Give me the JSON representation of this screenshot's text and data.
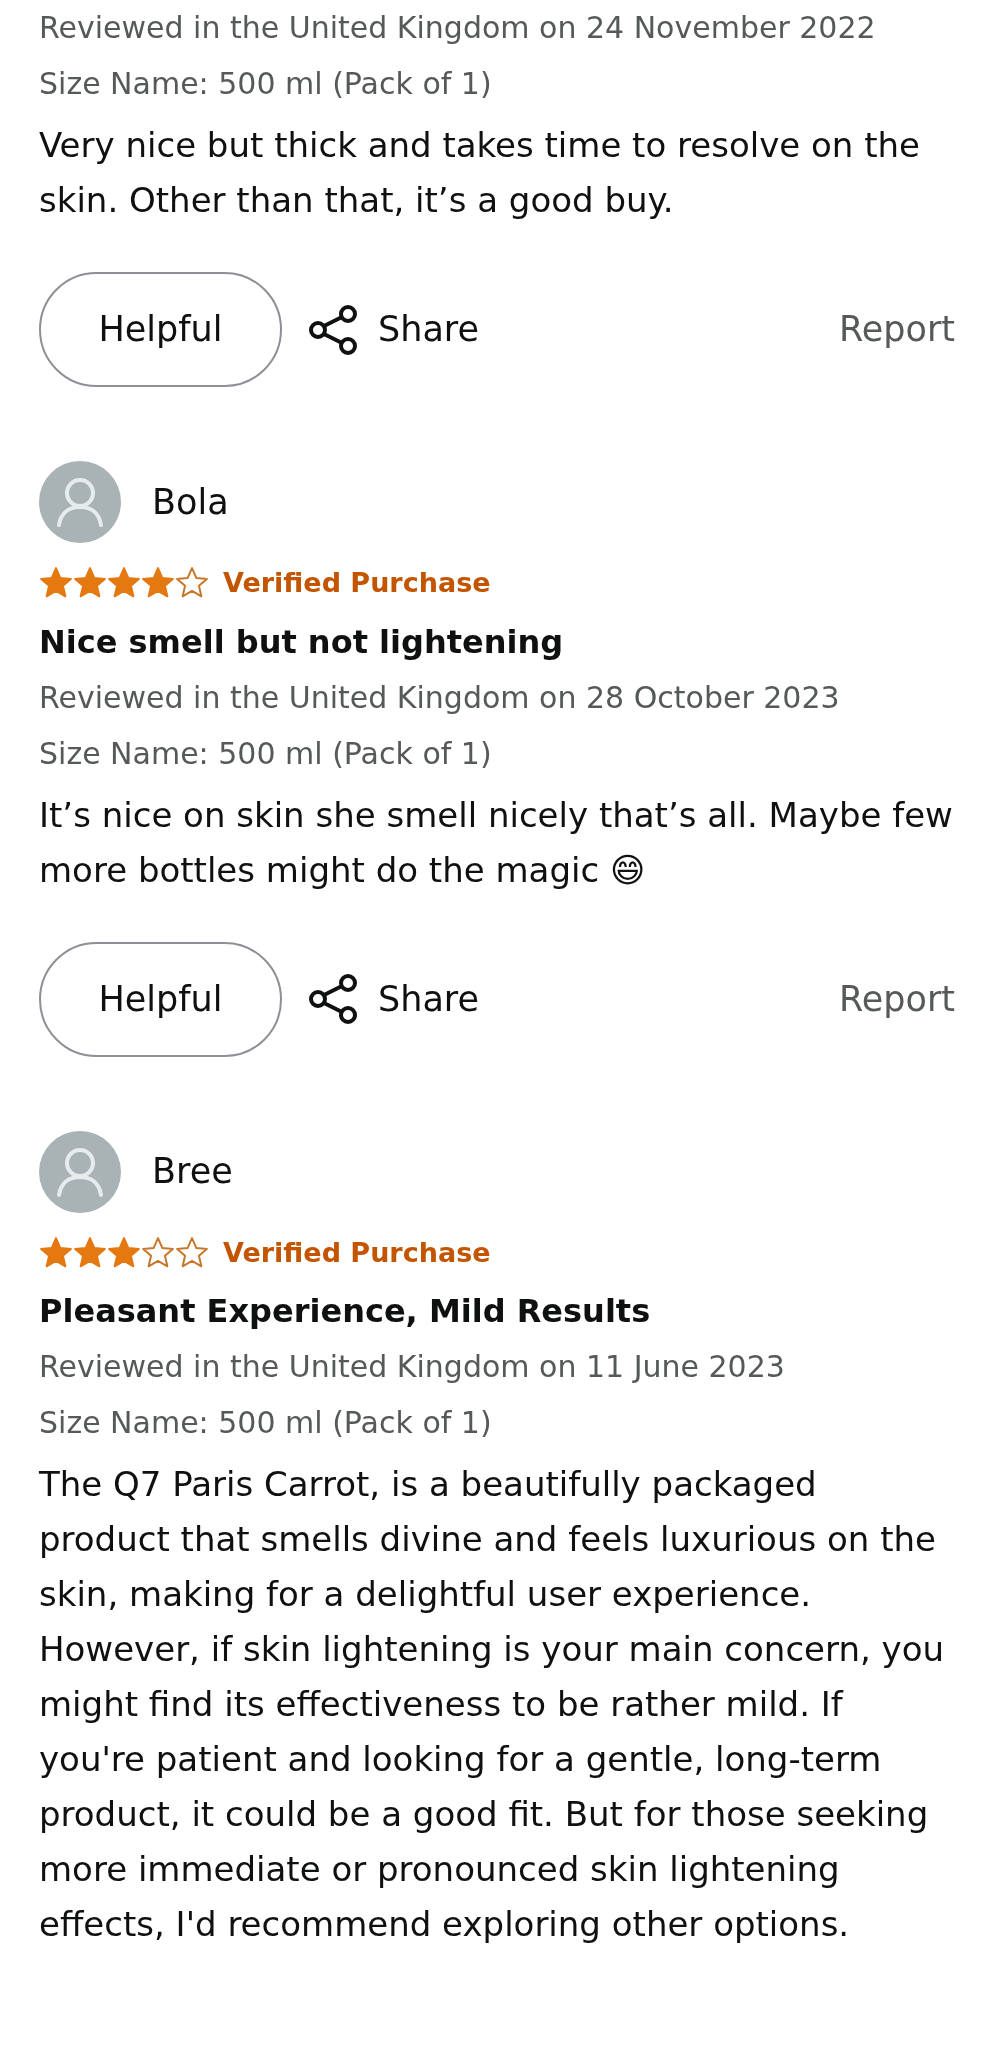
{
  "reviews": [
    {
      "reviewed": "Reviewed in the United Kingdom on 24 November 2022",
      "size": "Size Name: 500 ml (Pack of 1)",
      "body": "Very nice but thick and takes time to resolve on the skin. Other than that, it’s a good buy.",
      "helpful": "Helpful",
      "share": "Share",
      "report": "Report"
    },
    {
      "author": "Bola",
      "stars": 4,
      "verified": "Verified Purchase",
      "title": "Nice smell but not lightening",
      "reviewed": "Reviewed in the United Kingdom on 28 October 2023",
      "size": "Size Name: 500 ml (Pack of 1)",
      "body": "It’s nice on skin she smell nicely that’s all. Maybe few more bottles might do the magic 😄",
      "helpful": "Helpful",
      "share": "Share",
      "report": "Report"
    },
    {
      "author": "Bree",
      "stars": 3,
      "verified": "Verified Purchase",
      "title": "Pleasant Experience, Mild Results",
      "reviewed": "Reviewed in the United Kingdom on 11 June 2023",
      "size": "Size Name: 500 ml (Pack of 1)",
      "body": "The Q7 Paris Carrot, is a beautifully packaged product that smells divine and feels luxurious on the skin, making for a delightful user experience. However, if skin lightening is your main concern, you might find its effectiveness to be rather mild. If you're patient and looking for a gentle, long-term product, it could be a good fit. But for those seeking more immediate or pronounced skin lightening effects, I'd recommend exploring other options."
    }
  ]
}
